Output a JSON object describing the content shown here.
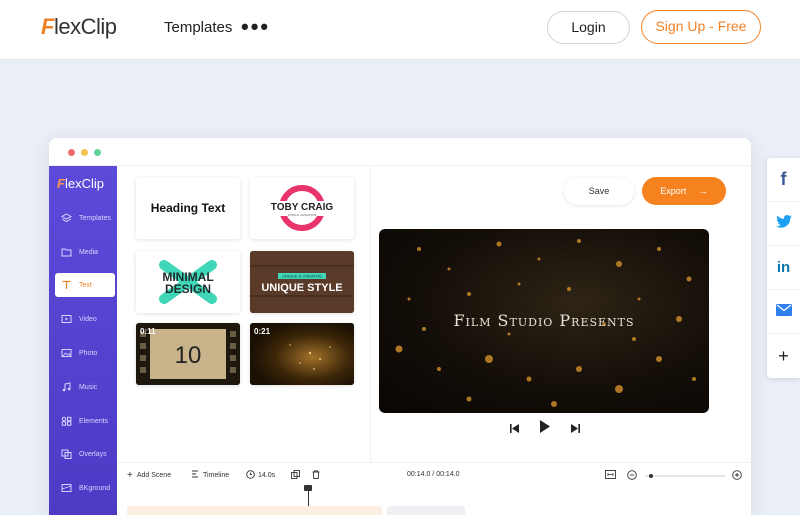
{
  "header": {
    "logo_text": "lexClip",
    "logo_initial": "F",
    "nav_templates": "Templates",
    "nav_more": "•••",
    "login_label": "Login",
    "signup_label": "Sign Up - Free"
  },
  "editor": {
    "sidebar_logo_initial": "F",
    "sidebar_logo_text": "lexClip",
    "sidebar_items": [
      {
        "label": "Templates",
        "icon": "layers-icon"
      },
      {
        "label": "Media",
        "icon": "folder-icon"
      },
      {
        "label": "Text",
        "icon": "text-icon",
        "active": true
      },
      {
        "label": "Video",
        "icon": "video-icon"
      },
      {
        "label": "Photo",
        "icon": "photo-icon"
      },
      {
        "label": "Music",
        "icon": "music-icon"
      },
      {
        "label": "Elements",
        "icon": "elements-icon"
      },
      {
        "label": "Overlays",
        "icon": "overlays-icon"
      },
      {
        "label": "BKground",
        "icon": "background-icon"
      }
    ],
    "text_templates": {
      "heading_text": "Heading Text",
      "toby_title": "TOBY CRAIG",
      "toby_sub": "WORLD CHAMPION",
      "minimal_line1": "MINIMAL",
      "minimal_line2": "DESIGN",
      "unique_tag": "UNIQUE & CREATIVE",
      "unique_title": "UNIQUE STYLE",
      "film_duration": "0:11",
      "film_number": "10",
      "gold_duration": "0:21"
    },
    "save_label": "Save",
    "export_label": "Export",
    "preview_title": "Film Studio Presents",
    "timeline": {
      "add_scene": "Add Scene",
      "timeline_label": "Timeline",
      "duration": "14.0s",
      "time_display": "00:14.0 / 00:14.0"
    }
  },
  "colors": {
    "accent": "#f5821f",
    "sidebar": "#5b4bd8",
    "facebook": "#3b5998",
    "twitter": "#1da1f2",
    "linkedin": "#0e76a8",
    "email": "#2f80ed"
  },
  "share": {
    "facebook_label": "f",
    "linkedin_label": "in",
    "more_label": "+"
  }
}
